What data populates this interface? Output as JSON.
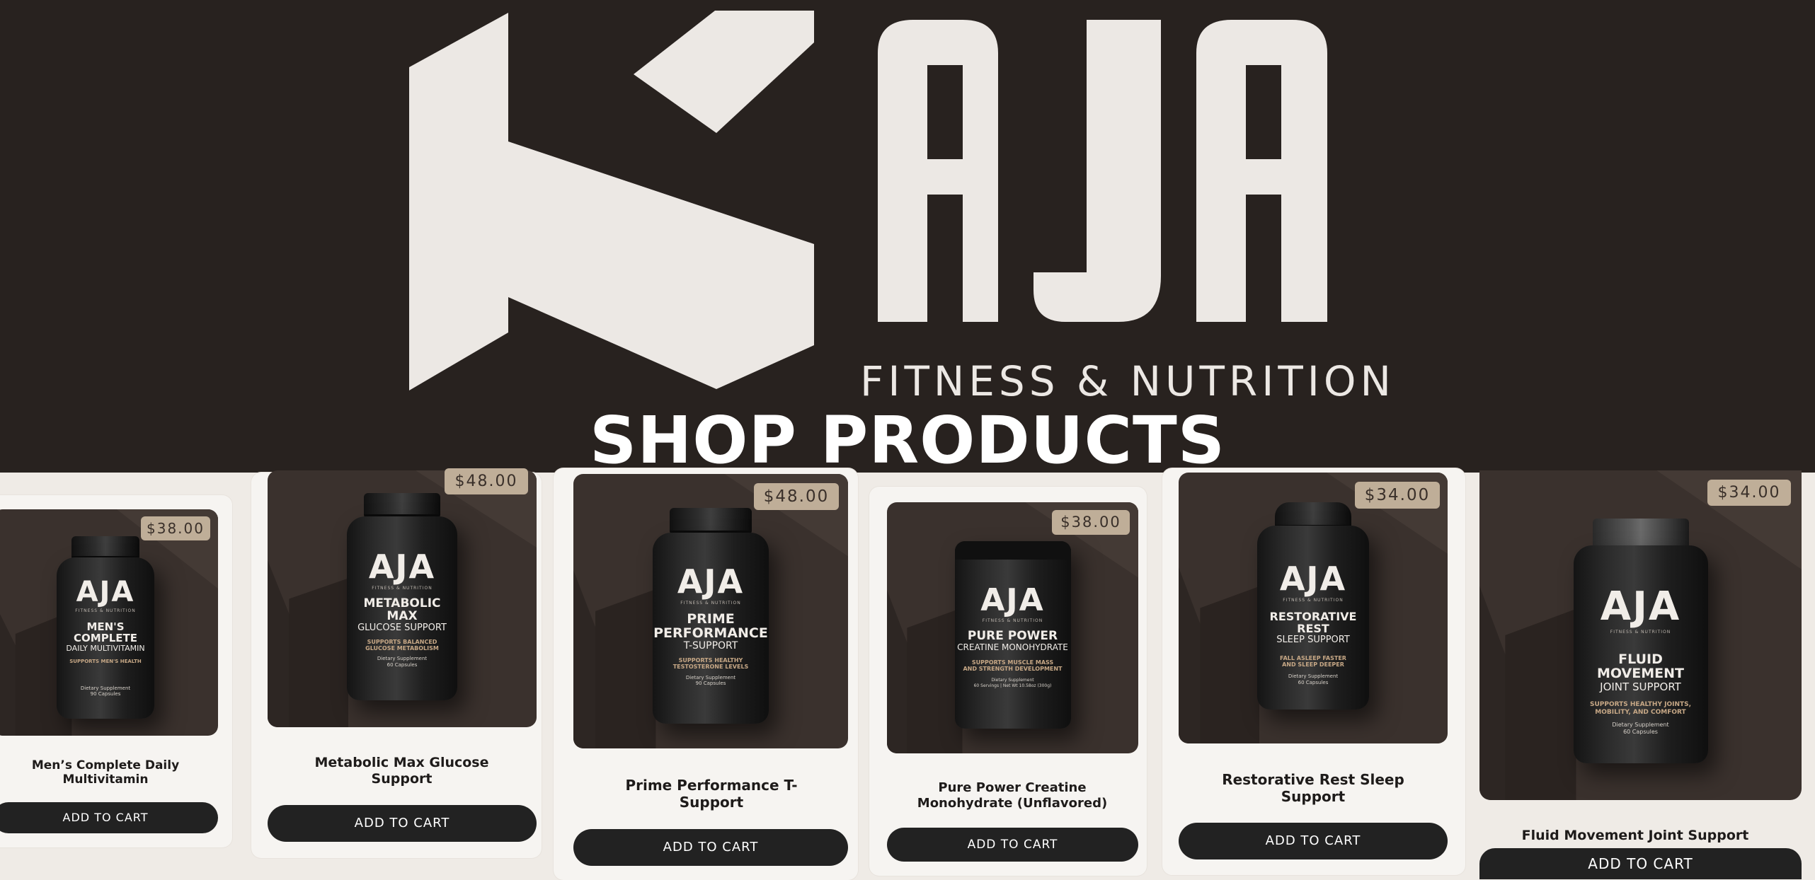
{
  "brand": {
    "logo_text": "AJA",
    "tagline": "FITNESS & NUTRITION"
  },
  "page": {
    "title": "SHOP PRODUCTS"
  },
  "colors": {
    "hero_bg": "#28221f",
    "page_bg": "#efebe6",
    "card_bg": "#f6f4f1",
    "price_badge": "#bfae98",
    "button_bg": "#222222",
    "product_image_bg": "#3a312d"
  },
  "products": [
    {
      "name": "Men’s Complete Daily Multivitamin",
      "price": "$38.00",
      "button": "ADD TO CART",
      "label": {
        "brand": "AJA",
        "sub": "FITNESS & NUTRITION",
        "name": "MEN'S COMPLETE",
        "desc": "DAILY MULTIVITAMIN",
        "support": "SUPPORTS MEN'S HEALTH",
        "foot": "Dietary Supplement\n90 Capsules"
      }
    },
    {
      "name": "Metabolic Max Glucose Support",
      "price": "$48.00",
      "button": "ADD TO CART",
      "label": {
        "brand": "AJA",
        "sub": "FITNESS & NUTRITION",
        "name": "METABOLIC MAX",
        "desc": "GLUCOSE SUPPORT",
        "support": "SUPPORTS BALANCED\nGLUCOSE METABOLISM",
        "foot": "Dietary Supplement\n60 Capsules"
      }
    },
    {
      "name": "Prime Performance T-Support",
      "price": "$48.00",
      "button": "ADD TO CART",
      "label": {
        "brand": "AJA",
        "sub": "FITNESS & NUTRITION",
        "name": "PRIME\nPERFORMANCE",
        "desc": "T-SUPPORT",
        "support": "SUPPORTS HEALTHY\nTESTOSTERONE LEVELS",
        "foot": "Dietary Supplement\n90 Capsules"
      }
    },
    {
      "name": "Pure Power Creatine Monohydrate (Unflavored)",
      "price": "$38.00",
      "button": "ADD TO CART",
      "label": {
        "brand": "AJA",
        "sub": "FITNESS & NUTRITION",
        "name": "PURE POWER",
        "desc": "CREATINE MONOHYDRATE",
        "support": "SUPPORTS MUSCLE MASS\nAND STRENGTH DEVELOPMENT",
        "foot": "Dietary Supplement\n60 Servings | Net Wt 10.58oz (300g)"
      }
    },
    {
      "name": "Restorative Rest Sleep Support",
      "price": "$34.00",
      "button": "ADD TO CART",
      "label": {
        "brand": "AJA",
        "sub": "FITNESS & NUTRITION",
        "name": "RESTORATIVE REST",
        "desc": "SLEEP SUPPORT",
        "support": "FALL ASLEEP FASTER\nAND SLEEP DEEPER",
        "foot": "Dietary Supplement\n60 Capsules"
      }
    },
    {
      "name": "Fluid Movement Joint Support",
      "price": "$34.00",
      "button": "ADD TO CART",
      "label": {
        "brand": "AJA",
        "sub": "FITNESS & NUTRITION",
        "name": "FLUID MOVEMENT",
        "desc": "JOINT SUPPORT",
        "support": "SUPPORTS HEALTHY JOINTS,\nMOBILITY, AND COMFORT",
        "foot": "Dietary Supplement\n60 Capsules"
      }
    }
  ]
}
